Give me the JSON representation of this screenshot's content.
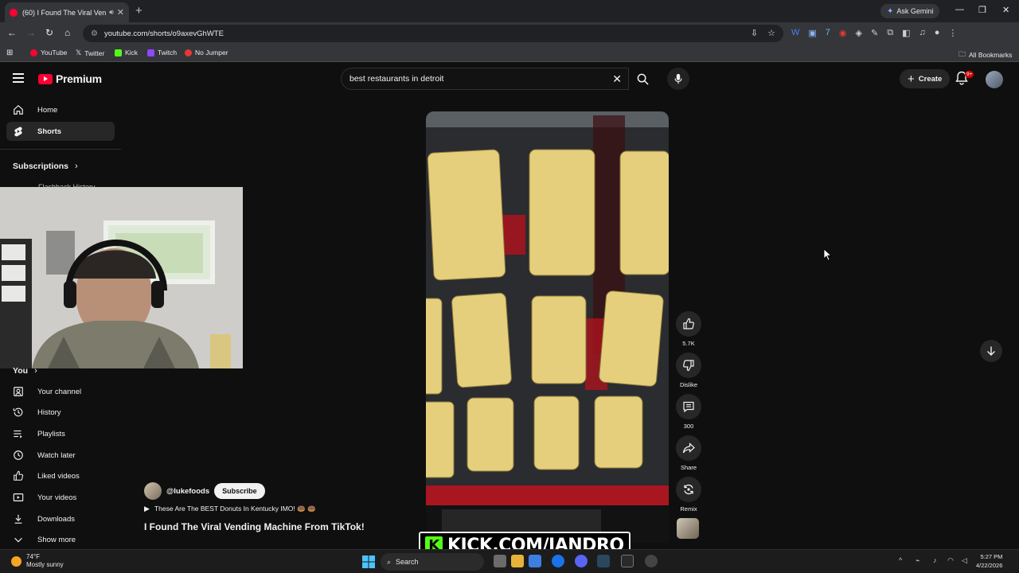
{
  "browser": {
    "tab_title": "(60) I Found The Viral Vend",
    "url": "youtube.com/shorts/o9axevGhWTE",
    "gemini_label": "Ask Gemini",
    "bookmarks": [
      {
        "label": "YouTube",
        "color": "#ff0033"
      },
      {
        "label": "Twitter",
        "color": "#ffffff"
      },
      {
        "label": "Kick",
        "color": "#53fc18"
      },
      {
        "label": "Twitch",
        "color": "#9146ff"
      },
      {
        "label": "No Jumper",
        "color": "#e53935"
      }
    ],
    "all_bookmarks": "All Bookmarks"
  },
  "youtube": {
    "logo_text": "Premium",
    "search_value": "best restaurants in detroit",
    "create_label": "Create",
    "notif_badge": "9+"
  },
  "sidebar": {
    "items": [
      {
        "label": "Home",
        "icon": "home-icon"
      },
      {
        "label": "Shorts",
        "icon": "shorts-icon"
      }
    ],
    "subscriptions": "Subscriptions",
    "partial_item": "Flashback History",
    "you": "You",
    "you_items": [
      {
        "label": "Your channel",
        "icon": "channel-icon"
      },
      {
        "label": "History",
        "icon": "history-icon"
      },
      {
        "label": "Playlists",
        "icon": "playlists-icon"
      },
      {
        "label": "Watch later",
        "icon": "clock-icon"
      },
      {
        "label": "Liked videos",
        "icon": "thumbs-up-icon"
      },
      {
        "label": "Your videos",
        "icon": "video-icon"
      },
      {
        "label": "Downloads",
        "icon": "download-icon"
      },
      {
        "label": "Show more",
        "icon": "chevron-down-icon"
      }
    ]
  },
  "short": {
    "channel": "@lukefoods",
    "subscribe": "Subscribe",
    "linked_video": "These Are The BEST Donuts In Kentucky IMO! 🍩 🍩",
    "title": "I Found The Viral Vending Machine From TikTok!",
    "likes": "5.7K",
    "dislike": "Dislike",
    "comments": "300",
    "share": "Share",
    "remix": "Remix"
  },
  "overlay": {
    "kick_text": "KICK.COM/JANDRO"
  },
  "taskbar": {
    "temp": "74°F",
    "weather": "Mostly sunny",
    "search": "Search",
    "time": "5:27 PM",
    "date": "4/22/2026"
  }
}
